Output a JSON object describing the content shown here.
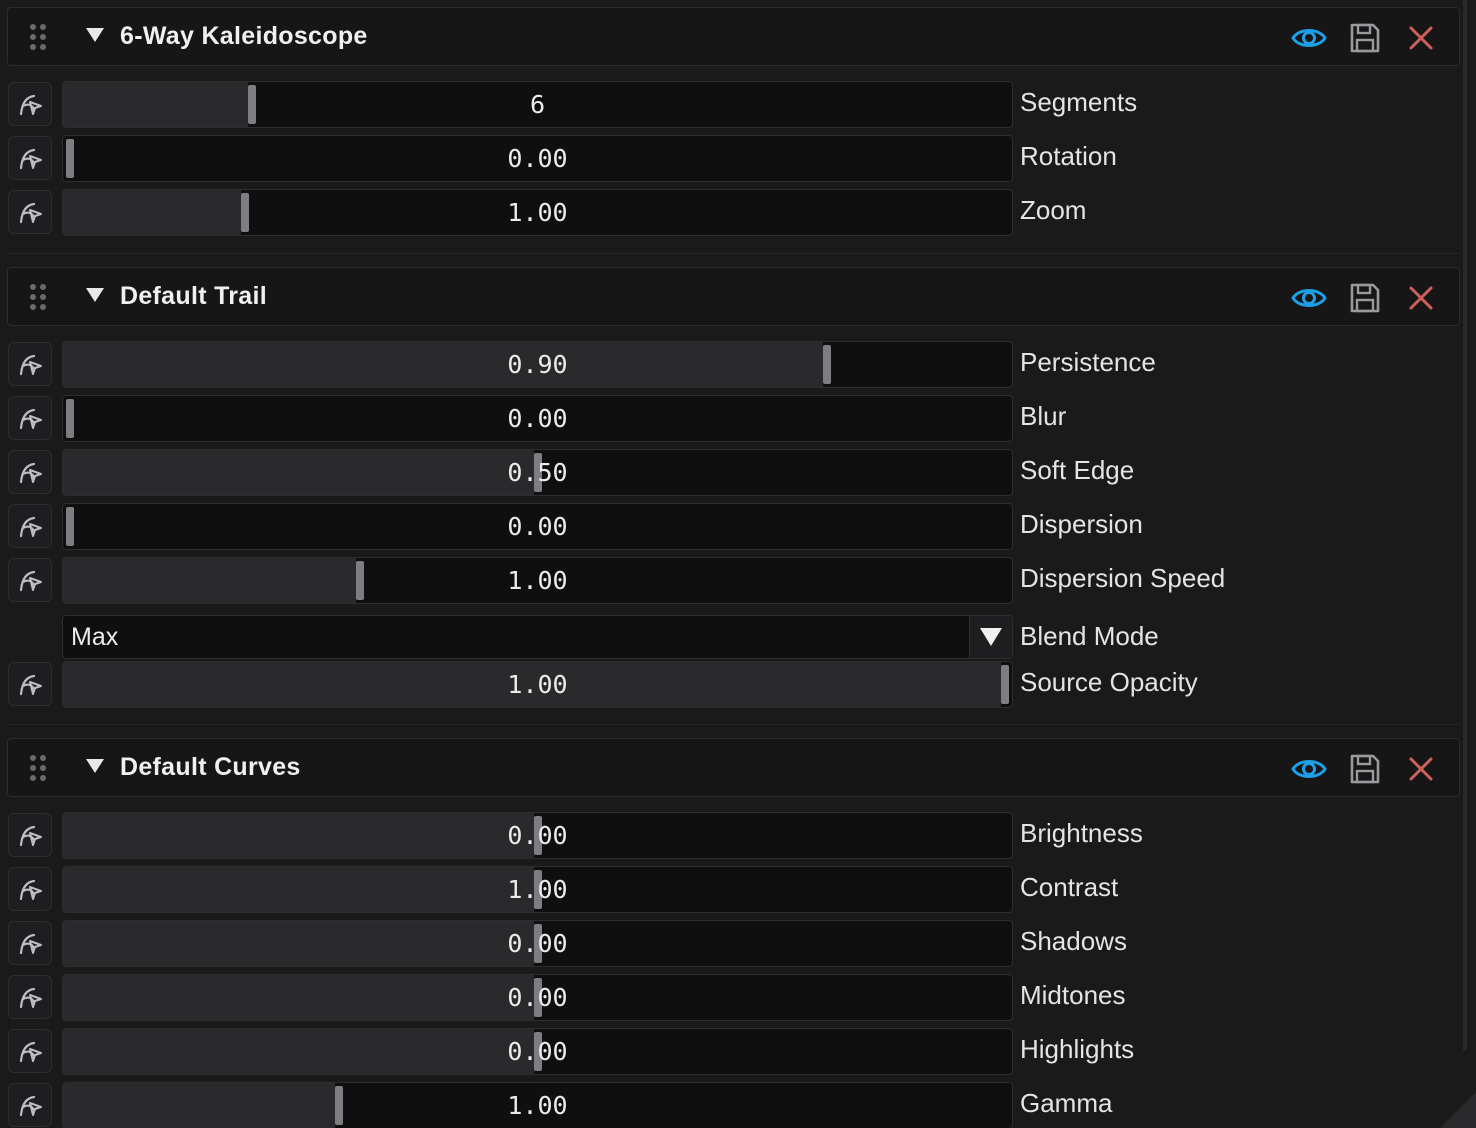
{
  "colors": {
    "eye": "#1e9fe6",
    "save": "#9a9a9e",
    "close": "#d0605a"
  },
  "icons": {
    "drag": "drag-handle-icon",
    "collapse": "collapse-triangle-icon",
    "visibility": "eye-icon",
    "save": "save-icon",
    "remove": "close-icon",
    "modulate": "modulate-curve-icon",
    "dropdown": "dropdown-triangle-icon"
  },
  "sections": [
    {
      "title": "6-Way Kaleidoscope",
      "params": [
        {
          "label": "Segments",
          "value": "6",
          "fill": 0.195
        },
        {
          "label": "Rotation",
          "value": "0.00",
          "fill": 0.0
        },
        {
          "label": "Zoom",
          "value": "1.00",
          "fill": 0.187
        }
      ]
    },
    {
      "title": "Default Trail",
      "params": [
        {
          "label": "Persistence",
          "value": "0.90",
          "fill": 0.81
        },
        {
          "label": "Blur",
          "value": "0.00",
          "fill": 0.0
        },
        {
          "label": "Soft Edge",
          "value": "0.50",
          "fill": 0.5
        },
        {
          "label": "Dispersion",
          "value": "0.00",
          "fill": 0.0
        },
        {
          "label": "Dispersion Speed",
          "value": "1.00",
          "fill": 0.31
        },
        {
          "label": "Blend Mode",
          "type": "select",
          "value": "Max"
        },
        {
          "label": "Source Opacity",
          "value": "1.00",
          "fill": 1.0
        }
      ]
    },
    {
      "title": "Default Curves",
      "params": [
        {
          "label": "Brightness",
          "value": "0.00",
          "fill": 0.5
        },
        {
          "label": "Contrast",
          "value": "1.00",
          "fill": 0.5
        },
        {
          "label": "Shadows",
          "value": "0.00",
          "fill": 0.5
        },
        {
          "label": "Midtones",
          "value": "0.00",
          "fill": 0.5
        },
        {
          "label": "Highlights",
          "value": "0.00",
          "fill": 0.5
        },
        {
          "label": "Gamma",
          "value": "1.00",
          "fill": 0.288
        }
      ]
    }
  ]
}
